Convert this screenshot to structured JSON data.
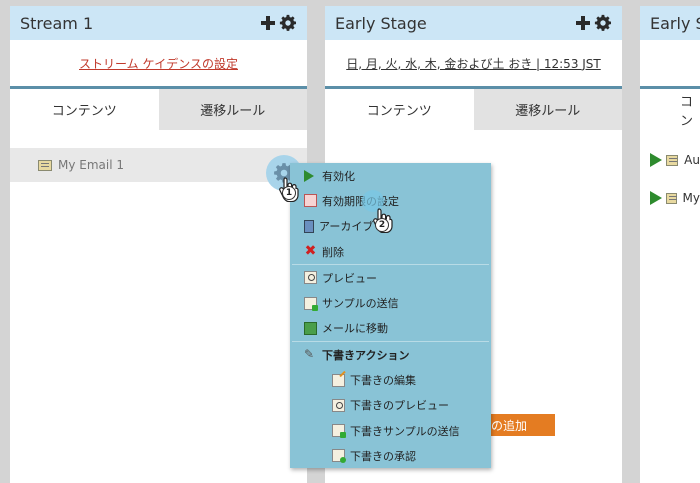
{
  "streams": [
    {
      "title": "Stream 1",
      "cadence_link": "ストリーム ケイデンスの設定",
      "tabs": [
        "コンテンツ",
        "遷移ルール"
      ],
      "items": [
        {
          "name": "My Email 1"
        }
      ]
    },
    {
      "title": "Early Stage",
      "cadence_link": "日, 月, 火, 水, 木, 金および土 おき | 12:53 JST",
      "tabs": [
        "コンテンツ",
        "遷移ルール"
      ],
      "add_button": "の追加"
    },
    {
      "title": "Early S",
      "tab_partial": "コン",
      "items": [
        {
          "name": "Au"
        },
        {
          "name": "My"
        }
      ]
    }
  ],
  "context_menu": {
    "groups": [
      [
        {
          "label": "有効化",
          "icon": "play-icon"
        },
        {
          "label": "有効期限の設定",
          "icon": "expiry-icon"
        },
        {
          "label": "アーカイブ",
          "icon": "archive-icon"
        },
        {
          "label": "削除",
          "icon": "delete-icon"
        }
      ],
      [
        {
          "label": "プレビュー",
          "icon": "preview-icon"
        },
        {
          "label": "サンプルの送信",
          "icon": "send-sample-icon"
        },
        {
          "label": "メールに移動",
          "icon": "go-to-email-icon"
        }
      ],
      [
        {
          "label": "下書きアクション",
          "icon": "pencil-icon",
          "bold": true
        },
        {
          "label": "下書きの編集",
          "icon": "edit-draft-icon",
          "sub": true
        },
        {
          "label": "下書きのプレビュー",
          "icon": "preview-draft-icon",
          "sub": true
        },
        {
          "label": "下書きサンプルの送信",
          "icon": "send-draft-sample-icon",
          "sub": true
        },
        {
          "label": "下書きの承認",
          "icon": "approve-draft-icon",
          "sub": true
        }
      ]
    ]
  },
  "step_badges": [
    "1",
    "2"
  ],
  "colors": {
    "header_bg": "#cce6f6",
    "menu_bg": "#89c3d6",
    "add_button": "#e47c22",
    "cadence_link_red": "#c0392b"
  }
}
